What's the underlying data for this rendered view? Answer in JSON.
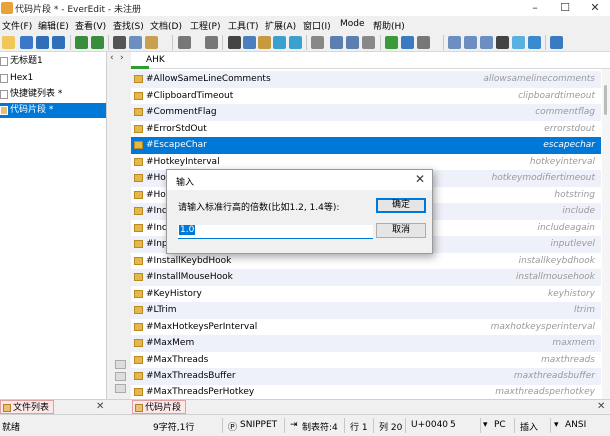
{
  "window": {
    "title": "代码片段 * - EverEdit - 未注册"
  },
  "menu": {
    "items": [
      "文件(F)",
      "编辑(E)",
      "查看(V)",
      "查找(S)",
      "文档(D)",
      "工程(P)",
      "工具(T)",
      "扩展(A)",
      "窗口(I)",
      "Mode",
      "帮助(H)"
    ]
  },
  "left_pane": {
    "items": [
      {
        "label": "无标题1"
      },
      {
        "label": "Hex1"
      },
      {
        "label": "快捷键列表 *"
      },
      {
        "label": "代码片段 *"
      }
    ]
  },
  "editor": {
    "header": "AHK",
    "rows": [
      {
        "key": "#AllowSameLineComments",
        "value": "allowsamelinecomments"
      },
      {
        "key": "#ClipboardTimeout",
        "value": "clipboardtimeout"
      },
      {
        "key": "#CommentFlag",
        "value": "commentflag"
      },
      {
        "key": "#ErrorStdOut",
        "value": "errorstdout"
      },
      {
        "key": "#EscapeChar",
        "value": "escapechar"
      },
      {
        "key": "#HotkeyInterval",
        "value": "hotkeyinterval"
      },
      {
        "key": "#Hotk",
        "value": "hotkeymodifiertimeout"
      },
      {
        "key": "#Hots",
        "value": "hotstring"
      },
      {
        "key": "#Inclu",
        "value": "include"
      },
      {
        "key": "#Inclu",
        "value": "includeagain"
      },
      {
        "key": "#Inpu",
        "value": "inputlevel"
      },
      {
        "key": "#InstallKeybdHook",
        "value": "installkeybdhook"
      },
      {
        "key": "#InstallMouseHook",
        "value": "installmousehook"
      },
      {
        "key": "#KeyHistory",
        "value": "keyhistory"
      },
      {
        "key": "#LTrim",
        "value": "ltrim"
      },
      {
        "key": "#MaxHotkeysPerInterval",
        "value": "maxhotkeysperinterval"
      },
      {
        "key": "#MaxMem",
        "value": "maxmem"
      },
      {
        "key": "#MaxThreads",
        "value": "maxthreads"
      },
      {
        "key": "#MaxThreadsBuffer",
        "value": "maxthreadsbuffer"
      },
      {
        "key": "#MaxThreadsPerHotkey",
        "value": "maxthreadsperhotkey"
      }
    ]
  },
  "bottom_tabs": {
    "left": "文件列表",
    "right": "代码片段"
  },
  "status": {
    "ready": "就绪",
    "chars": "9字符,1行",
    "mode": "SNIPPET",
    "tab": "制表符:4",
    "line": "行 1",
    "col": "列 20",
    "code": "U+0040",
    "num": "5",
    "eol": "PC",
    "insert": "插入",
    "encoding": "ANSI"
  },
  "dialog": {
    "title": "输入",
    "prompt": "请输入标准行高的倍数(比如1.2, 1.4等):",
    "value": "1.0",
    "ok": "确定",
    "cancel": "取消"
  },
  "colors": {
    "accent": "#0078d7",
    "row_alt": "#eef0fa"
  }
}
